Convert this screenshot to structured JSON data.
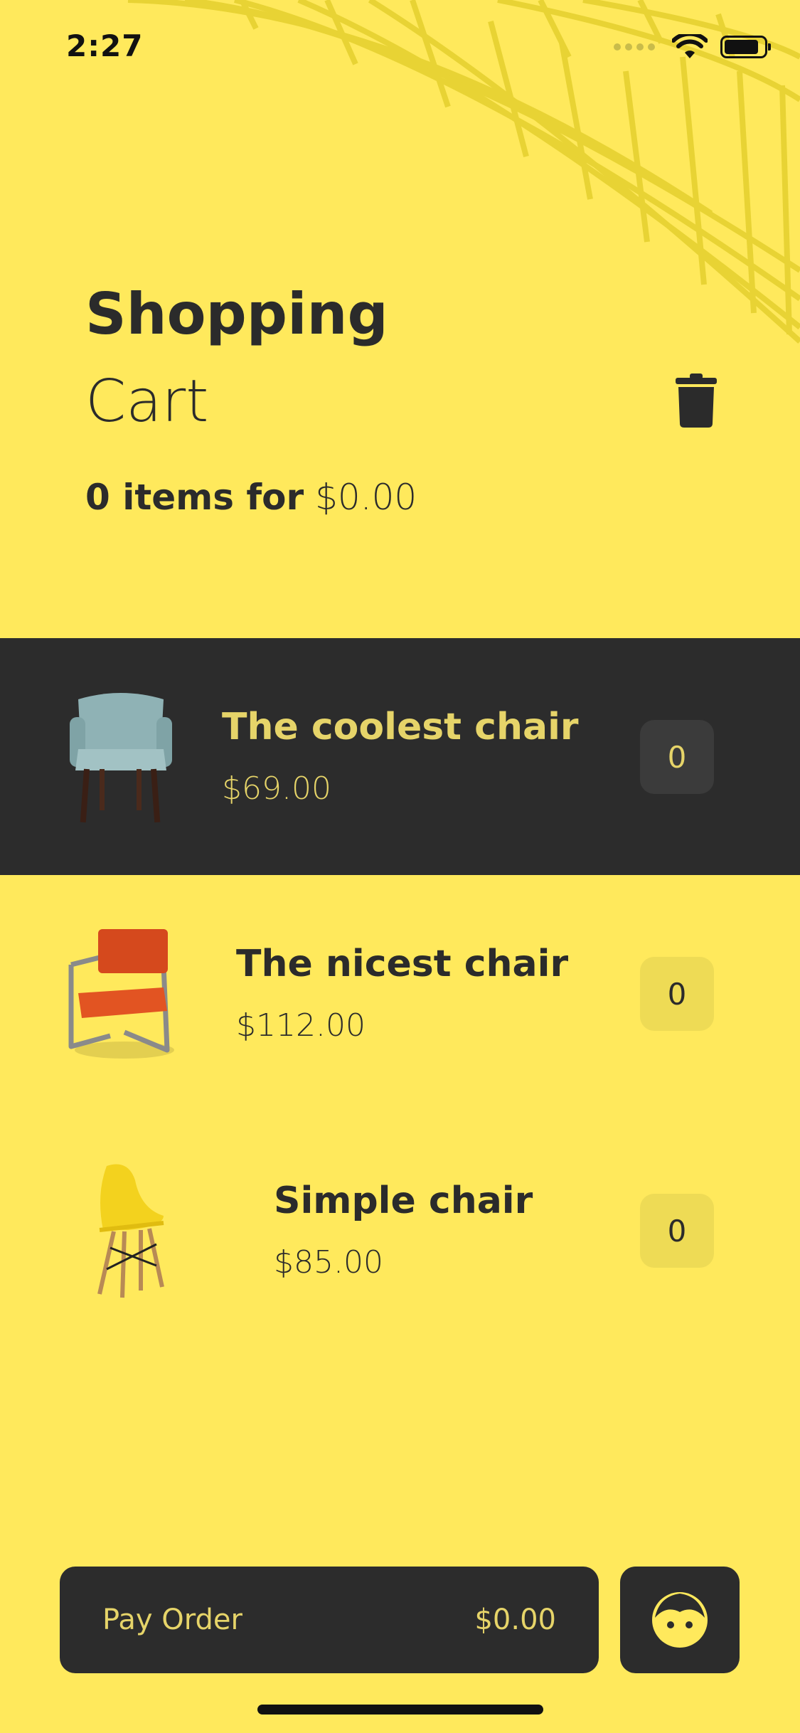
{
  "status_bar": {
    "time": "2:27"
  },
  "header": {
    "title_line1": "Shopping",
    "title_line2": "Cart",
    "summary_count": "0 items for",
    "summary_total": "$0.00"
  },
  "cart_items": [
    {
      "name": "The coolest chair",
      "price": "$69.00",
      "quantity": "0",
      "selected": true
    },
    {
      "name": "The nicest chair",
      "price": "$112.00",
      "quantity": "0",
      "selected": false
    },
    {
      "name": "Simple chair",
      "price": "$85.00",
      "quantity": "0",
      "selected": false
    }
  ],
  "footer": {
    "pay_label": "Pay Order",
    "pay_total": "$0.00"
  },
  "icons": [
    "trash-icon",
    "profile-face-icon",
    "wifi-icon",
    "battery-icon"
  ],
  "colors": {
    "background": "#FFE95C",
    "dark": "#2C2C2C",
    "accent_text": "#E6D469",
    "quantity_chip": "#EEDB55"
  }
}
